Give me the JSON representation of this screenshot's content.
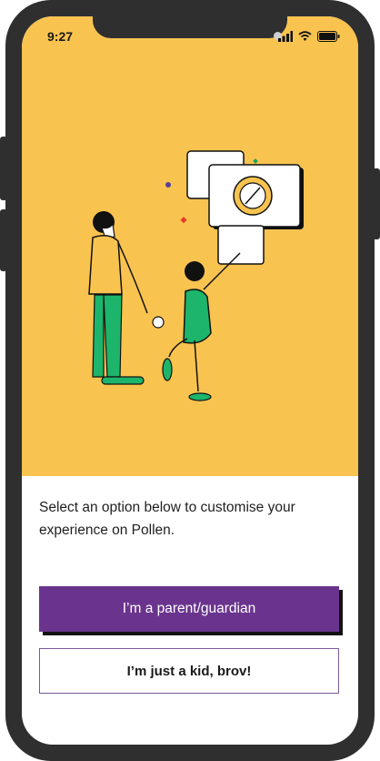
{
  "status_bar": {
    "time": "9:27",
    "icons": [
      "signal-icon",
      "wifi-icon",
      "battery-icon"
    ]
  },
  "hero": {
    "background_color": "#f9c350",
    "illustration": "parent-and-child-pressing-button-illustration"
  },
  "intro_text": "Select an option below to customise your experience on Pollen.",
  "buttons": {
    "parent_label": "I’m a parent/guardian",
    "kid_label": "I’m just a kid, brov!"
  },
  "colors": {
    "primary_button": "#6a348e",
    "secondary_border": "#7a5a9a",
    "frame": "#2f2f2f"
  }
}
